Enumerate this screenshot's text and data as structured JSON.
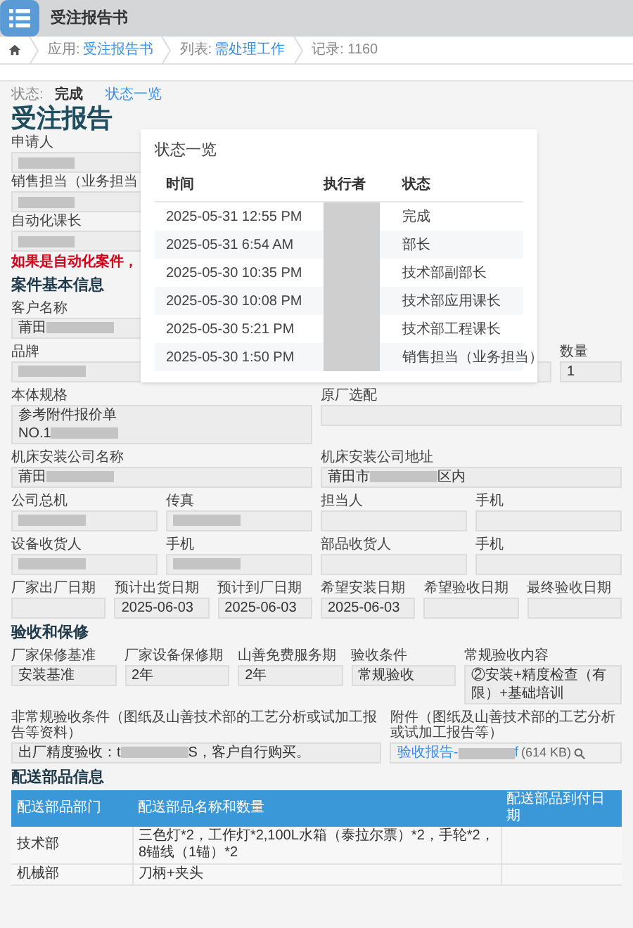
{
  "app": {
    "title": "受注报告书"
  },
  "breadcrumb": [
    {
      "label": "应用:",
      "link": "受注报告书"
    },
    {
      "label": "列表:",
      "link": "需处理工作"
    },
    {
      "label": "记录: 1160"
    }
  ],
  "status": {
    "label": "状态:",
    "value": "完成",
    "link": "状态一览"
  },
  "form_title": "受注报告",
  "top_fields": [
    {
      "label": "申请人",
      "redacted": true
    },
    {
      "label": "销售担当（业务担当",
      "redacted": true
    },
    {
      "label": "自动化课长",
      "redacted": true
    }
  ],
  "warning": "如果是自动化案件，",
  "sections": [
    {
      "title": "案件基本信息",
      "rows": [
        {
          "fields": [
            {
              "kind": "text",
              "label": "客户名称",
              "value": "莆田",
              "redacted": true
            }
          ]
        },
        {
          "fields": [
            {
              "kind": "text",
              "label": "品牌",
              "redacted": true
            },
            {
              "kind": "text",
              "label": "数量",
              "value": "1"
            }
          ]
        },
        {
          "fields": [
            {
              "kind": "text",
              "label": "本体规格",
              "value": "参考附件报价单\nNO.1",
              "redacted": true
            },
            {
              "kind": "text",
              "label": "原厂选配"
            }
          ]
        },
        {
          "fields": [
            {
              "kind": "text",
              "label": "机床安装公司名称",
              "value": "莆田",
              "redacted": true
            },
            {
              "kind": "text",
              "label": "机床安装公司地址",
              "value": "莆田市",
              "redacted": true,
              "value_after": "区内"
            }
          ]
        },
        {
          "fields": [
            {
              "kind": "text",
              "label": "公司总机",
              "redacted": true
            },
            {
              "kind": "text",
              "label": "传真",
              "redacted": true
            },
            {
              "kind": "text",
              "label": "担当人"
            },
            {
              "kind": "text",
              "label": "手机"
            }
          ]
        },
        {
          "fields": [
            {
              "kind": "text",
              "label": "设备收货人",
              "redacted": true
            },
            {
              "kind": "text",
              "label": "手机",
              "redacted": true
            },
            {
              "kind": "text",
              "label": "部品收货人"
            },
            {
              "kind": "text",
              "label": "手机"
            }
          ]
        },
        {
          "fields": [
            {
              "kind": "text",
              "label": "厂家出厂日期"
            },
            {
              "kind": "text",
              "label": "预计出货日期",
              "value": "2025-06-03"
            },
            {
              "kind": "text",
              "label": "预计到厂日期",
              "value": "2025-06-03"
            },
            {
              "kind": "text",
              "label": "希望安装日期",
              "value": "2025-06-03"
            },
            {
              "kind": "text",
              "label": "希望验收日期"
            },
            {
              "kind": "text",
              "label": "最终验收日期"
            }
          ]
        }
      ]
    },
    {
      "title": "验收和保修",
      "rows": [
        {
          "fields": [
            {
              "kind": "text",
              "label": "厂家保修基准",
              "value": "安装基准"
            },
            {
              "kind": "text",
              "label": "厂家设备保修期",
              "value": "2年"
            },
            {
              "kind": "text",
              "label": "山善免费服务期",
              "value": "2年"
            },
            {
              "kind": "text",
              "label": "验收条件",
              "value": "常规验收"
            },
            {
              "kind": "text",
              "label": "常规验收内容",
              "value": "②安装+精度检查（有限）+基础培训"
            }
          ]
        },
        {
          "fields": [
            {
              "kind": "text",
              "label": "非常规验收条件（图纸及山善技术部的工艺分析或试加工报告等资料）",
              "value": "出厂精度验收：t",
              "redacted": true,
              "value_after": "S，客户自行购买。"
            },
            {
              "kind": "attachment",
              "label": "附件（图纸及山善技术部的工艺分析或试加工报告等）",
              "link": "验收报告-",
              "link_after": "f",
              "size": "(614 KB)"
            }
          ]
        }
      ]
    }
  ],
  "parts": {
    "title": "配送部品信息",
    "columns": [
      "配送部品部门",
      "配送部品名称和数量",
      "配送部品到付日期"
    ],
    "rows": [
      {
        "department": "技术部",
        "items": "三色灯*2，工作灯*2,100L水箱（泰拉尔票）*2，手轮*2，8锚线（1锚）*2"
      },
      {
        "department": "机械部",
        "items": "刀柄+夹头"
      }
    ]
  },
  "status_dialog": {
    "title": "状态一览",
    "columns": [
      "时间",
      "执行者",
      "状态"
    ],
    "rows": [
      {
        "time": "2025-05-31 12:55 PM",
        "status": "完成"
      },
      {
        "time": "2025-05-31 6:54 AM",
        "status": "部长"
      },
      {
        "time": "2025-05-30 10:35 PM",
        "status": "技术部副部长"
      },
      {
        "time": "2025-05-30 10:08 PM",
        "status": "技术部应用课长"
      },
      {
        "time": "2025-05-30 5:21 PM",
        "status": "技术部工程课长"
      },
      {
        "time": "2025-05-30 1:50 PM",
        "status": "销售担当（业务担当）"
      }
    ]
  }
}
